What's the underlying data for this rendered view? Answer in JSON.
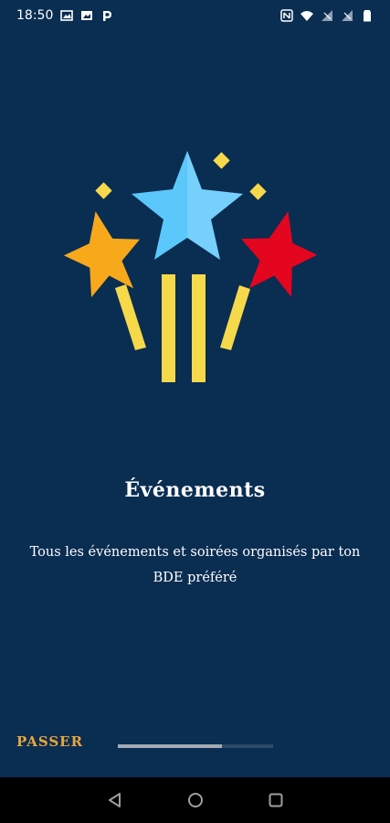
{
  "status_bar": {
    "time": "18:50",
    "left_icons": [
      "gallery-icon",
      "image-icon",
      "parking-app-icon"
    ],
    "right_icons": [
      "nfc-icon",
      "wifi-icon",
      "signal-icon",
      "signal-icon",
      "battery-icon"
    ]
  },
  "onboarding": {
    "title": "Événements",
    "description": "Tous les événements et soirées organisés par ton BDE préféré",
    "skip_label": "PASSER",
    "progress": 0.67
  },
  "colors": {
    "background": "#0a2d52",
    "accent": "#e8a73a",
    "star_blue": "#5ac8fa",
    "star_orange": "#f7a81b",
    "star_red": "#e4051f",
    "beams": "#f6d94a"
  },
  "nav_bar": {
    "buttons": [
      "back-icon",
      "home-icon",
      "recents-icon"
    ]
  }
}
